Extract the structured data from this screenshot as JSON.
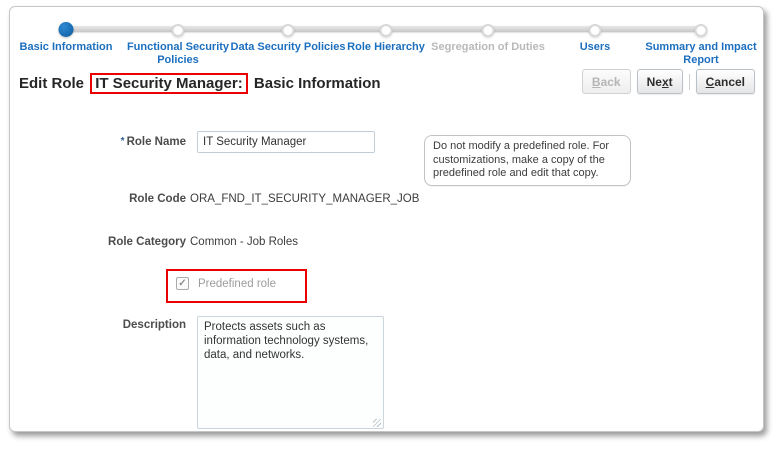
{
  "train": {
    "steps": [
      {
        "label": "Basic Information",
        "state": "active"
      },
      {
        "label": "Functional Security Policies",
        "state": "enabled"
      },
      {
        "label": "Data Security Policies",
        "state": "enabled"
      },
      {
        "label": "Role Hierarchy",
        "state": "enabled"
      },
      {
        "label": "Segregation of Duties",
        "state": "disabled"
      },
      {
        "label": "Users",
        "state": "enabled"
      },
      {
        "label": "Summary and Impact Report",
        "state": "enabled"
      }
    ]
  },
  "header": {
    "title_prefix": "Edit Role",
    "title_highlight": "IT Security Manager:",
    "title_suffix": "Basic Information"
  },
  "toolbar": {
    "back": {
      "pre": "",
      "key": "B",
      "post": "ack"
    },
    "next": {
      "pre": "Ne",
      "key": "x",
      "post": "t"
    },
    "cancel": {
      "pre": "",
      "key": "C",
      "post": "ancel"
    }
  },
  "form": {
    "role_name": {
      "label": "Role Name",
      "required_marker": "*",
      "value": "IT Security Manager"
    },
    "role_code": {
      "label": "Role Code",
      "value": "ORA_FND_IT_SECURITY_MANAGER_JOB"
    },
    "role_category": {
      "label": "Role Category",
      "value": "Common - Job Roles"
    },
    "predefined_role": {
      "label": "Predefined role",
      "checked": true,
      "checkbox_glyph": "✓"
    },
    "description": {
      "label": "Description",
      "value": "Protects assets such as information technology systems, data, and networks."
    }
  },
  "info_box": {
    "text": "Do not modify a predefined role. For customizations, make a copy of the predefined role and edit that copy."
  },
  "colors": {
    "accent_blue": "#1a6fb5",
    "step_label_blue": "#1c6fbf",
    "step_disabled_gray": "#b9b9b9",
    "annotation_red": "#ea0000",
    "label_gray": "#4c4c4c"
  }
}
